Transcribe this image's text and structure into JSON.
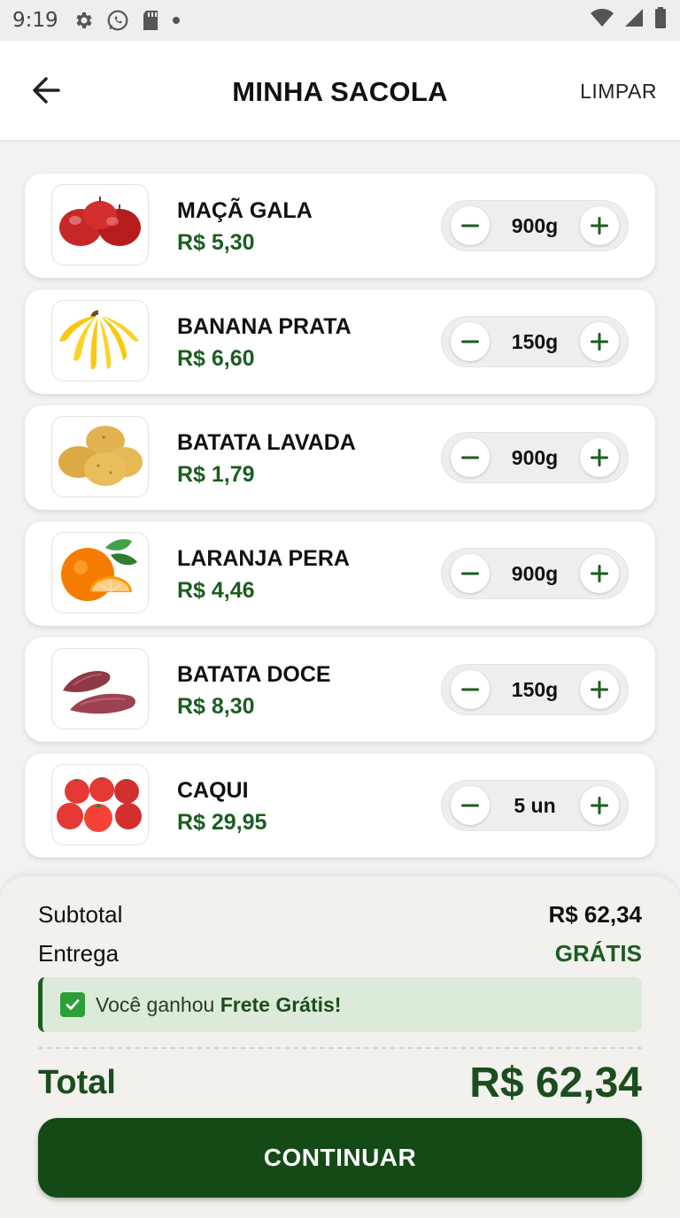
{
  "status_bar": {
    "time": "9:19",
    "left_icons": [
      "gear-icon",
      "whatsapp-icon",
      "sd-card-icon",
      "dot-icon"
    ],
    "right_icons": [
      "wifi-icon",
      "signal-icon",
      "battery-icon"
    ]
  },
  "header": {
    "title": "MINHA SACOLA",
    "back_icon": "arrow-left-icon",
    "clear_label": "LIMPAR"
  },
  "items": [
    {
      "name": "MAÇÃ GALA",
      "price": "R$ 5,30",
      "qty": "900g",
      "image": "apple-icon"
    },
    {
      "name": "BANANA PRATA",
      "price": "R$ 6,60",
      "qty": "150g",
      "image": "banana-icon"
    },
    {
      "name": "BATATA LAVADA",
      "price": "R$ 1,79",
      "qty": "900g",
      "image": "potato-icon"
    },
    {
      "name": "LARANJA PERA",
      "price": "R$ 4,46",
      "qty": "900g",
      "image": "orange-icon"
    },
    {
      "name": "BATATA DOCE",
      "price": "R$ 8,30",
      "qty": "150g",
      "image": "sweet-potato-icon"
    },
    {
      "name": "CAQUI",
      "price": "R$ 29,95",
      "qty": "5 un",
      "image": "persimmon-icon"
    }
  ],
  "summary": {
    "subtotal_label": "Subtotal",
    "subtotal_value": "R$ 62,34",
    "delivery_label": "Entrega",
    "delivery_value": "GRÁTIS",
    "banner_text": "Você ganhou ",
    "banner_bold": "Frete Grátis!",
    "total_label": "Total",
    "total_value": "R$ 62,34",
    "continue_label": "CONTINUAR"
  },
  "colors": {
    "primary_green": "#1b5e20",
    "button_green": "#144a16",
    "banner_bg": "#dcebd9",
    "check_green": "#2e9e36"
  }
}
